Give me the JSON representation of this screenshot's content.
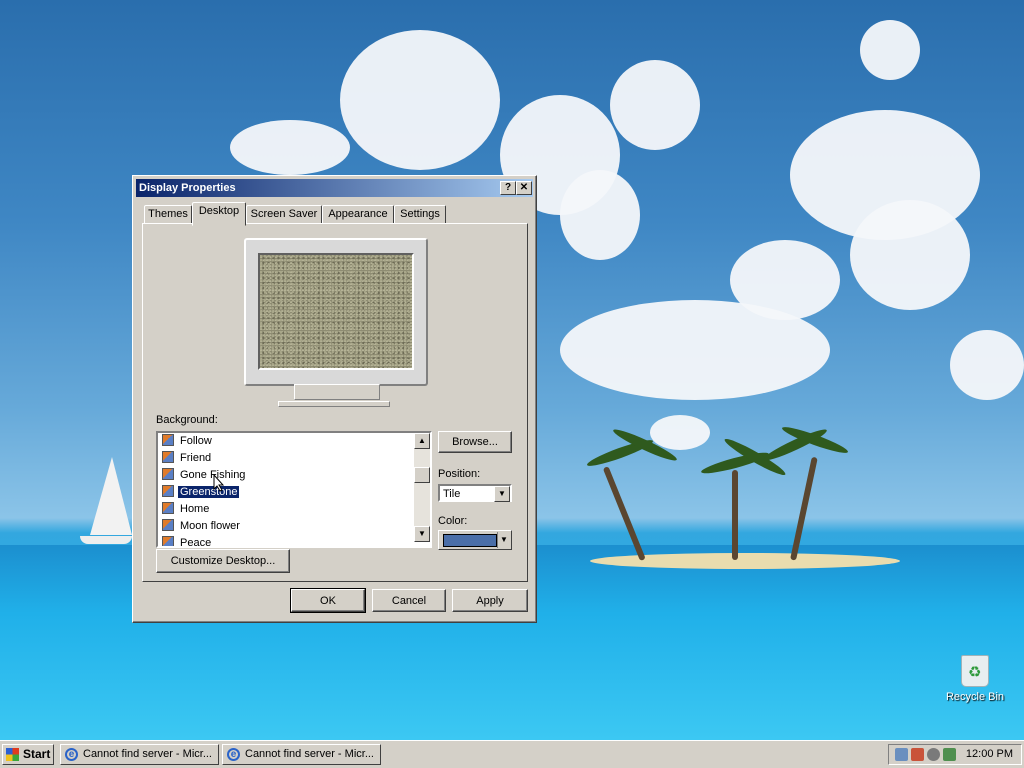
{
  "desktop": {
    "recycle_bin_label": "Recycle Bin"
  },
  "dialog": {
    "title": "Display Properties",
    "help_button": "?",
    "close_button": "✕",
    "tabs": [
      {
        "label": "Themes",
        "active": false
      },
      {
        "label": "Desktop",
        "active": true
      },
      {
        "label": "Screen Saver",
        "active": false
      },
      {
        "label": "Appearance",
        "active": false
      },
      {
        "label": "Settings",
        "active": false
      }
    ],
    "background_label": "Background:",
    "background_items": [
      {
        "label": "Follow",
        "selected": false
      },
      {
        "label": "Friend",
        "selected": false
      },
      {
        "label": "Gone Fishing",
        "selected": false
      },
      {
        "label": "Greenstone",
        "selected": true
      },
      {
        "label": "Home",
        "selected": false
      },
      {
        "label": "Moon flower",
        "selected": false
      },
      {
        "label": "Peace",
        "selected": false
      }
    ],
    "browse_button": "Browse...",
    "position_label": "Position:",
    "position_value": "Tile",
    "color_label": "Color:",
    "color_value": "#4a6ea8",
    "customize_button": "Customize Desktop...",
    "ok_button": "OK",
    "cancel_button": "Cancel",
    "apply_button": "Apply"
  },
  "taskbar": {
    "start_label": "Start",
    "tasks": [
      {
        "label": "Cannot find server - Micr..."
      },
      {
        "label": "Cannot find server - Micr..."
      }
    ],
    "clock": "12:00 PM"
  },
  "colors": {
    "title_bar": "#0a246a",
    "selection": "#0a246a",
    "window_face": "#d4d0c8"
  }
}
